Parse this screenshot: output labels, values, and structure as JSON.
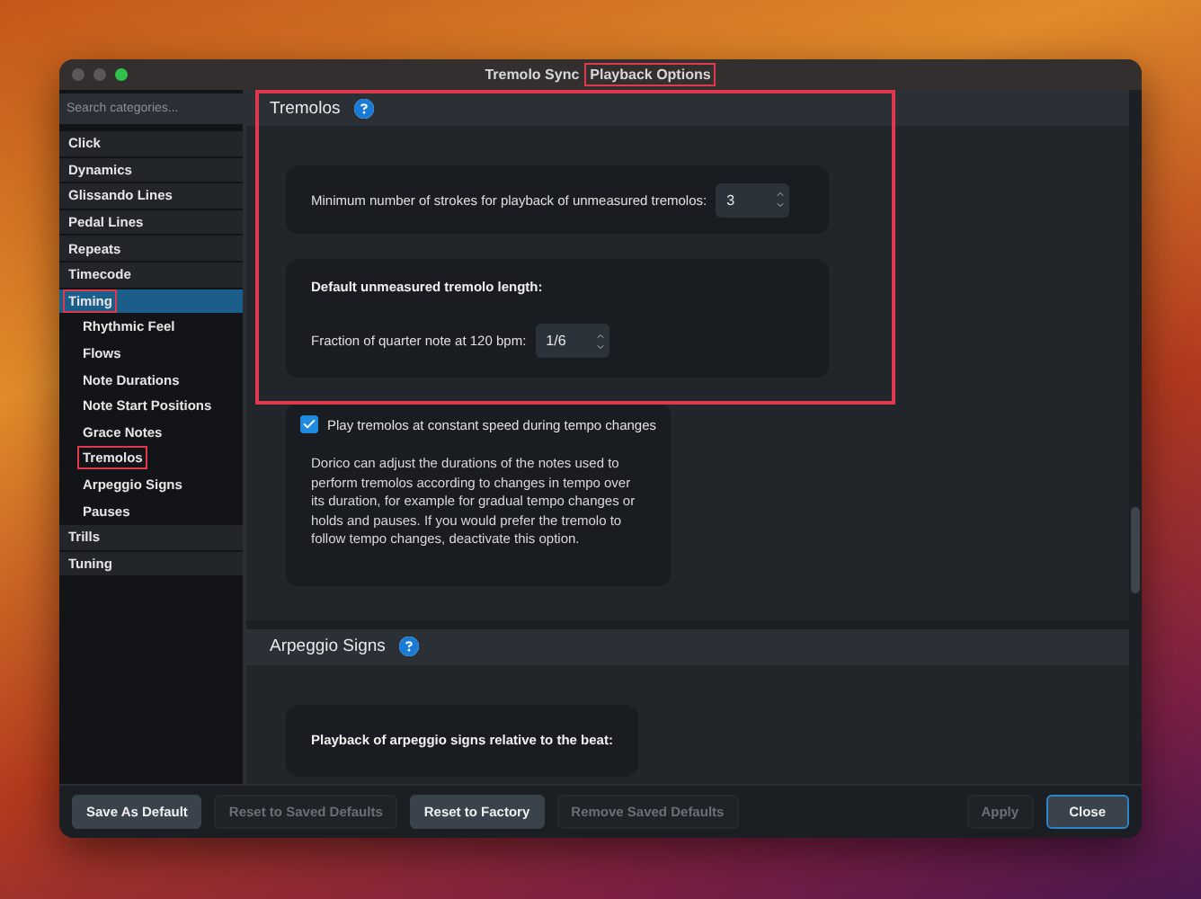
{
  "window": {
    "title": "Tremolo Sync",
    "subtitle": {
      "text": "Playback Options",
      "highlighted": true
    }
  },
  "sidebar": {
    "search": {
      "placeholder": "Search categories..."
    },
    "items": [
      {
        "label": "Click",
        "selected": false,
        "highlighted": false
      },
      {
        "label": "Dynamics",
        "selected": false,
        "highlighted": false
      },
      {
        "label": "Glissando Lines",
        "selected": false,
        "highlighted": false
      },
      {
        "label": "Pedal Lines",
        "selected": false,
        "highlighted": false
      },
      {
        "label": "Repeats",
        "selected": false,
        "highlighted": false
      },
      {
        "label": "Timecode",
        "selected": false,
        "highlighted": false
      },
      {
        "label": "Timing",
        "selected": true,
        "highlighted": true,
        "children": [
          {
            "label": "Rhythmic Feel",
            "selected": false,
            "highlighted": false
          },
          {
            "label": "Flows",
            "selected": false,
            "highlighted": false
          },
          {
            "label": "Note Durations",
            "selected": false,
            "highlighted": false
          },
          {
            "label": "Note Start Positions",
            "selected": false,
            "highlighted": false
          },
          {
            "label": "Grace Notes",
            "selected": false,
            "highlighted": false
          },
          {
            "label": "Tremolos",
            "selected": false,
            "highlighted": true
          },
          {
            "label": "Arpeggio Signs",
            "selected": false,
            "highlighted": false
          },
          {
            "label": "Pauses",
            "selected": false,
            "highlighted": false
          }
        ]
      },
      {
        "label": "Trills",
        "selected": false,
        "highlighted": false
      },
      {
        "label": "Tuning",
        "selected": false,
        "highlighted": false
      }
    ]
  },
  "sections": [
    {
      "title": "Tremolos",
      "highlighted": true,
      "cards": [
        {
          "kind": "stepper",
          "label": "Minimum number of strokes for playback of unmeasured tremolos:",
          "value": "3"
        },
        {
          "kind": "group",
          "heading": "Default unmeasured tremolo length:",
          "label": "Fraction of quarter note at 120 bpm:",
          "value": "1/6"
        },
        {
          "kind": "checkbox",
          "label": "Play tremolos at constant speed during tempo changes",
          "checked": true,
          "description": "Dorico can adjust the durations of the notes used to perform tremolos according to changes in tempo over its duration, for example for gradual tempo changes or holds and pauses. If you would prefer the tremolo to follow tempo changes, deactivate this option."
        }
      ]
    },
    {
      "title": "Arpeggio Signs",
      "highlighted": false,
      "cards": [
        {
          "kind": "heading",
          "heading": "Playback of arpeggio signs relative to the beat:"
        }
      ]
    }
  ],
  "footer": {
    "buttons": [
      {
        "label": "Save As Default",
        "disabled": false,
        "default": false
      },
      {
        "label": "Reset to Saved Defaults",
        "disabled": true,
        "default": false
      },
      {
        "label": "Reset to Factory",
        "disabled": false,
        "default": false
      },
      {
        "label": "Remove Saved Defaults",
        "disabled": true,
        "default": false
      }
    ],
    "actions": [
      {
        "label": "Apply",
        "disabled": true,
        "default": false
      },
      {
        "label": "Close",
        "disabled": false,
        "default": true
      }
    ]
  }
}
